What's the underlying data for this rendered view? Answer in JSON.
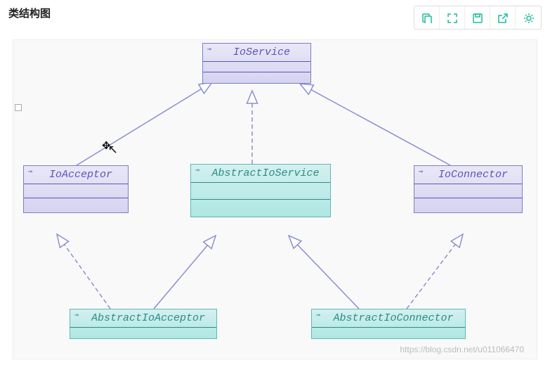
{
  "title": "类结构图",
  "toolbar": {
    "copy": "copy-icon",
    "expand": "expand-icon",
    "save": "save-icon",
    "share": "share-icon",
    "settings": "settings-icon"
  },
  "classes": {
    "ioservice": {
      "name": "IoService",
      "kind": "interface"
    },
    "ioacceptor": {
      "name": "IoAcceptor",
      "kind": "interface"
    },
    "abstractioservice": {
      "name": "AbstractIoService",
      "kind": "abstract"
    },
    "ioconnector": {
      "name": "IoConnector",
      "kind": "interface"
    },
    "abstractioacceptor": {
      "name": "AbstractIoAcceptor",
      "kind": "abstract"
    },
    "abstractioconnector": {
      "name": "AbstractIoConnector",
      "kind": "abstract"
    }
  },
  "relations": [
    {
      "from": "IoAcceptor",
      "to": "IoService",
      "type": "generalization"
    },
    {
      "from": "AbstractIoService",
      "to": "IoService",
      "type": "realization"
    },
    {
      "from": "IoConnector",
      "to": "IoService",
      "type": "generalization"
    },
    {
      "from": "AbstractIoAcceptor",
      "to": "IoAcceptor",
      "type": "realization"
    },
    {
      "from": "AbstractIoAcceptor",
      "to": "AbstractIoService",
      "type": "generalization"
    },
    {
      "from": "AbstractIoConnector",
      "to": "AbstractIoService",
      "type": "generalization"
    },
    {
      "from": "AbstractIoConnector",
      "to": "IoConnector",
      "type": "realization"
    }
  ],
  "watermark": "https://blog.csdn.net/u011066470"
}
